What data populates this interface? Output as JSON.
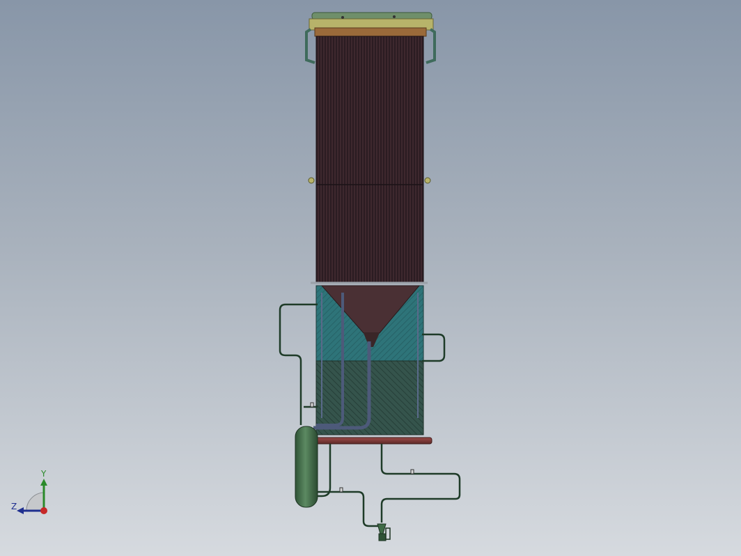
{
  "viewport": {
    "background_top": "#8896a8",
    "background_bottom": "#d6dadf"
  },
  "model": {
    "name": "boiler-assembly",
    "colors": {
      "tube_dark": "#2b1c22",
      "tube_line": "#5a3a40",
      "header": "#b7b36a",
      "header_top": "#6f8f6a",
      "hopper": "#4a3034",
      "insulation_teal": "#2e7479",
      "insulation_dark": "#2f4a44",
      "pipe": "#1e3b28",
      "pipe_blue": "#4d5a7a",
      "drum_green": "#3f6b46",
      "base_red": "#7a3a38"
    }
  },
  "triad": {
    "y_label": "Y",
    "z_label": "Z",
    "colors": {
      "y": "#2a8a2a",
      "z": "#1f2f8f",
      "origin": "#c62828"
    }
  }
}
